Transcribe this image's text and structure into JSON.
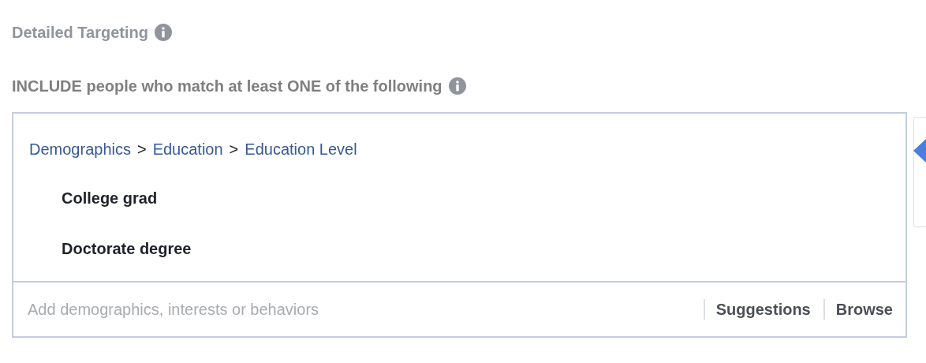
{
  "section": {
    "title": "Detailed Targeting"
  },
  "include": {
    "heading": "INCLUDE people who match at least ONE of the following"
  },
  "selection": {
    "breadcrumb": [
      {
        "kind": "link",
        "text": "Demographics"
      },
      {
        "kind": "separator",
        "text": ">"
      },
      {
        "kind": "link",
        "text": "Education"
      },
      {
        "kind": "separator",
        "text": ">"
      },
      {
        "kind": "link",
        "text": "Education Level"
      }
    ],
    "items": [
      "College grad",
      "Doctorate degree"
    ]
  },
  "search": {
    "placeholder": "Add demographics, interests or behaviors"
  },
  "actions": [
    "Suggestions",
    "Browse"
  ]
}
